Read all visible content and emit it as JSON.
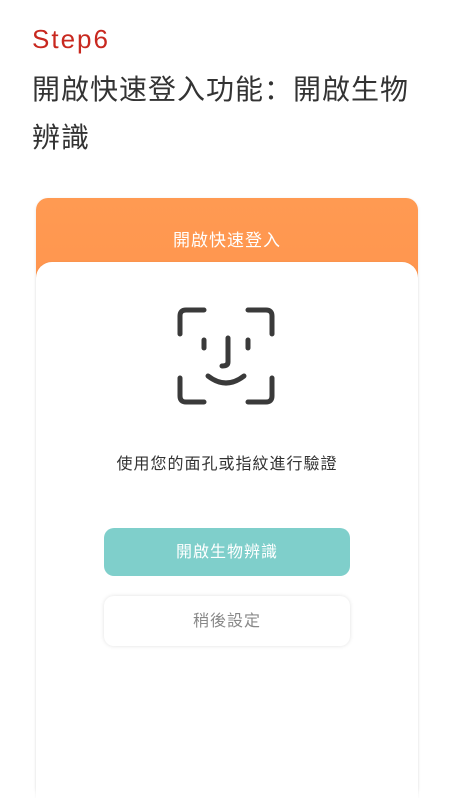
{
  "step": {
    "label": "Step6",
    "title": "開啟快速登入功能：開啟生物辨識"
  },
  "screen": {
    "header_title": "開啟快速登入",
    "icon": "face-id-icon",
    "description": "使用您的面孔或指紋進行驗證",
    "primary_button": "開啟生物辨識",
    "secondary_button": "稍後設定"
  },
  "colors": {
    "step_accent": "#c8281f",
    "header_gradient_top": "#ff9a52",
    "header_gradient_bottom": "#ff7a3c",
    "primary_button_bg": "#7fcfcb",
    "icon_stroke": "#3a3a3a"
  }
}
